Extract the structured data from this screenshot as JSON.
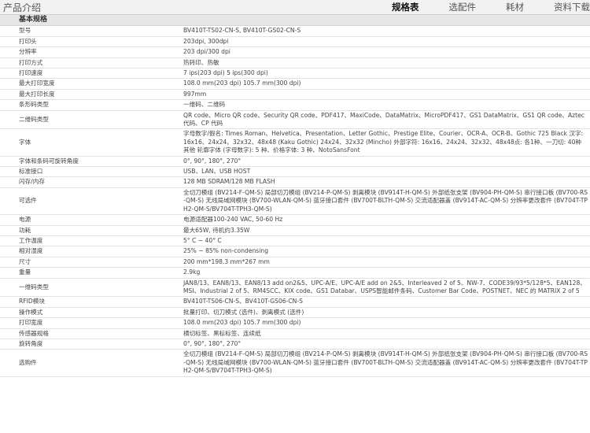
{
  "header": {
    "title": "产品介绍",
    "tabs": [
      {
        "label": "规格表",
        "active": true
      },
      {
        "label": "选配件",
        "active": false
      },
      {
        "label": "耗材",
        "active": false
      },
      {
        "label": "资料下载",
        "active": false
      }
    ]
  },
  "section_title": "基本规格",
  "rows": [
    {
      "key": "型号",
      "value": "BV410T-TS02-CN-S, BV410T-GS02-CN-S"
    },
    {
      "key": "打印头",
      "value": "203dpi, 300dpi"
    },
    {
      "key": "分辨率",
      "value": "203 dpi/300 dpi"
    },
    {
      "key": "打印方式",
      "value": "热转印、热敏"
    },
    {
      "key": "打印速度",
      "value": "7 ips(203 dpi) 5 ips(300 dpi)"
    },
    {
      "key": "最大打印宽度",
      "value": "108.0 mm(203 dpi) 105.7 mm(300 dpi)"
    },
    {
      "key": "最大打印长度",
      "value": "997mm"
    },
    {
      "key": "条形码类型",
      "value": "一维码、二维码"
    },
    {
      "key": "二维码类型",
      "value": "QR code、Micro QR code、Security QR code、PDF417、MaxiCode、DataMatrix、MicroPDF417、GS1 DataMatrix、GS1 QR code、Aztec 代码、CP 代码"
    },
    {
      "key": "字体",
      "value": "字母数字/假名: Times Roman、Helvetica、Presentation、Letter Gothic、Prestige Elite、Courier、OCR-A、OCR-B、Gothic 725 Black 汉字: 16x16、24x24、32x32、48x48 (Kaku Gothic) 24x24、32x32 (Mincho) 外部字符: 16x16、24x24、32x32、48x48点: 各1种、一刀切: 40种 其他 轮廓字体 (字母数字): 5 种、价格字体: 3 种、NotoSansFont"
    },
    {
      "key": "字体和条码可旋转角度",
      "value": "0°, 90°, 180°, 270°"
    },
    {
      "key": "标准接口",
      "value": "USB、LAN、USB HOST"
    },
    {
      "key": "闪存/内存",
      "value": "128 MB SDRAM/128 MB FLASH"
    },
    {
      "key": "可选件",
      "value": "全切刀模组 (BV214-F-QM-S) 局部切刀模组 (BV214-P-QM-S) 剥离模块 (BV914T-H-QM-S) 外部纸张支架 (BV904-PH-QM-S) 串行接口板 (BV700-RS-QM-S) 无线局域网模块 (BV700-WLAN-QM-S) 蓝牙接口套件 (BV700T-BLTH-QM-S) 交流适配器盖 (BV914T-AC-QM-S) 分辨率更改套件 (BV704T-TPH2-QM-S/BV704T-TPH3-QM-S)"
    },
    {
      "key": "电源",
      "value": "电源适配器100-240 VAC, 50-60 Hz"
    },
    {
      "key": "功耗",
      "value": "最大65W, 待机约3.35W"
    },
    {
      "key": "工作温度",
      "value": "5° C ~ 40° C"
    },
    {
      "key": "相对湿度",
      "value": "25% ~ 85% non-condensing"
    },
    {
      "key": "尺寸",
      "value": "200 mm*198.3 mm*267 mm"
    },
    {
      "key": "重量",
      "value": "2.9kg"
    },
    {
      "key": "一维码类型",
      "value": "JAN8/13、EAN8/13、EAN8/13 add on2&5、UPC-A/E、UPC-A/E add on 2&5、Interleaved 2 of 5、NW-7、CODE39/93*5/128*5、EAN128、MSI、Industrial 2 of 5、RM4SCC、KIX code、GS1 Databar、USPS智能邮件条码、Customer Bar Code、POSTNET、NEC 的 MATRIX 2 of 5"
    },
    {
      "key": "RFID模块",
      "value": "BV410T-TS06-CN-S、BV410T-GS06-CN-S"
    },
    {
      "key": "操作模式",
      "value": "批量打印、切刀模式 (选件)、剥离模式 (选件)"
    },
    {
      "key": "打印宽度",
      "value": "108.0 mm(203 dpi) 105.7 mm(300 dpi)"
    },
    {
      "key": "传感器规格",
      "value": "横切标签、黑标标签、连续纸"
    },
    {
      "key": "旋转角度",
      "value": "0°, 90°, 180°, 270°"
    },
    {
      "key": "选购件",
      "value": "全切刀模组 (BV214-F-QM-S) 局部切刀模组 (BV214-P-QM-S) 剥离模块 (BV914T-H-QM-S) 外部纸张支架 (BV904-PH-QM-S) 串行接口板 (BV700-RS-QM-S) 无线局域网模块 (BV700-WLAN-QM-S) 蓝牙接口套件 (BV700T-BLTH-QM-S) 交流适配器盖 (BV914T-AC-QM-S) 分辨率更改套件 (BV704T-TPH2-QM-S/BV704T-TPH3-QM-S)"
    }
  ]
}
